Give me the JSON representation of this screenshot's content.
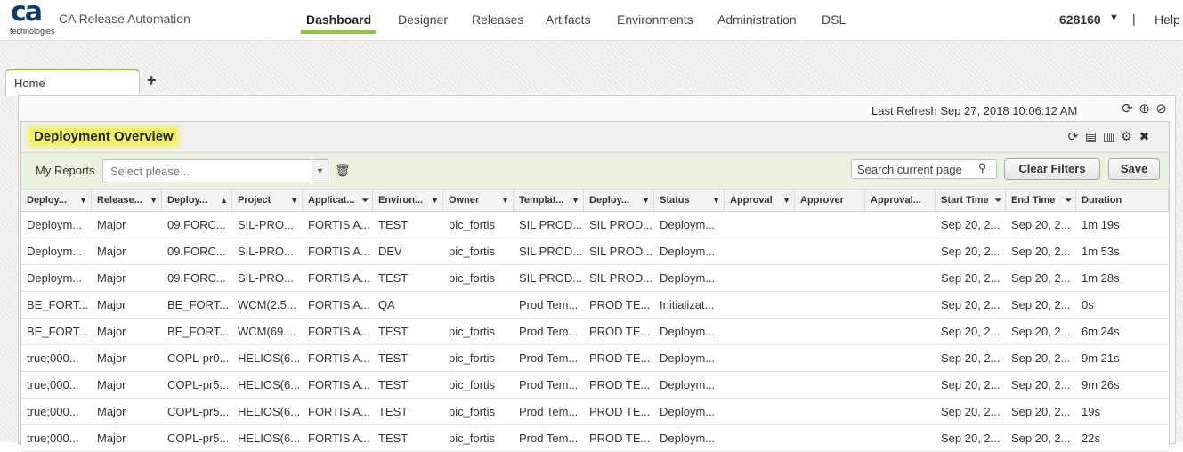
{
  "app": {
    "logo_text": "ca",
    "logo_sub": "technologies",
    "title": "CA Release Automation"
  },
  "nav": [
    "Dashboard",
    "Designer",
    "Releases",
    "Artifacts",
    "Environments",
    "Administration",
    "DSL"
  ],
  "user": {
    "name": "628160",
    "separator": "|",
    "help": "Help"
  },
  "tabs": {
    "home": "Home",
    "add": "+"
  },
  "dashboard": {
    "last_refresh": "Last Refresh Sep 27, 2018 10:06:12 AM"
  },
  "widget": {
    "title": "Deployment Overview",
    "my_reports_label": "My Reports",
    "select_placeholder": "Select please...",
    "search_placeholder": "Search current page",
    "clear_filters": "Clear Filters",
    "save": "Save"
  },
  "columns": [
    "Deploy...",
    "Release...",
    "Deploy...",
    "Project",
    "Applicat...",
    "Environ...",
    "Owner",
    "Templat...",
    "Deploy...",
    "Status",
    "Approval",
    "Approver",
    "Approval...",
    "Start Time",
    "End Time",
    "Duration"
  ],
  "rows": [
    [
      "Deploym...",
      "Major",
      "09.FORC...",
      "SIL-PRO...",
      "FORTIS A...",
      "TEST",
      "pic_fortis",
      "SIL PROD...",
      "SIL PROD...",
      "Deploym...",
      "",
      "",
      "",
      "Sep 20, 2...",
      "Sep 20, 2...",
      "1m 19s"
    ],
    [
      "Deploym...",
      "Major",
      "09.FORC...",
      "SIL-PRO...",
      "FORTIS A...",
      "DEV",
      "pic_fortis",
      "SIL PROD...",
      "SIL PROD...",
      "Deploym...",
      "",
      "",
      "",
      "Sep 20, 2...",
      "Sep 20, 2...",
      "1m 53s"
    ],
    [
      "Deploym...",
      "Major",
      "09.FORC...",
      "SIL-PRO...",
      "FORTIS A...",
      "TEST",
      "pic_fortis",
      "SIL PROD...",
      "SIL PROD...",
      "Deploym...",
      "",
      "",
      "",
      "Sep 20, 2...",
      "Sep 20, 2...",
      "1m 28s"
    ],
    [
      "BE_FORT...",
      "Major",
      "BE_FORT...",
      "WCM(2.5...",
      "FORTIS A...",
      "QA",
      "",
      "Prod Tem...",
      "PROD TE...",
      "Initializat...",
      "",
      "",
      "",
      "Sep 20, 2...",
      "Sep 20, 2...",
      "0s"
    ],
    [
      "BE_FORT...",
      "Major",
      "BE_FORT...",
      "WCM(69....",
      "FORTIS A...",
      "TEST",
      "pic_fortis",
      "Prod Tem...",
      "PROD TE...",
      "Deploym...",
      "",
      "",
      "",
      "Sep 20, 2...",
      "Sep 20, 2...",
      "6m 24s"
    ],
    [
      "true;000...",
      "Major",
      "COPL-pr0...",
      "HELIOS(6...",
      "FORTIS A...",
      "TEST",
      "pic_fortis",
      "Prod Tem...",
      "PROD TE...",
      "Deploym...",
      "",
      "",
      "",
      "Sep 20, 2...",
      "Sep 20, 2...",
      "9m 21s"
    ],
    [
      "true;000...",
      "Major",
      "COPL-pr5...",
      "HELIOS(6...",
      "FORTIS A...",
      "TEST",
      "pic_fortis",
      "Prod Tem...",
      "PROD TE...",
      "Deploym...",
      "",
      "",
      "",
      "Sep 20, 2...",
      "Sep 20, 2...",
      "9m 26s"
    ],
    [
      "true;000...",
      "Major",
      "COPL-pr5...",
      "HELIOS(6...",
      "FORTIS A...",
      "TEST",
      "pic_fortis",
      "Prod Tem...",
      "PROD TE...",
      "Deploym...",
      "",
      "",
      "",
      "Sep 20, 2...",
      "Sep 20, 2...",
      "19s"
    ],
    [
      "true;000...",
      "Major",
      "COPL-pr5...",
      "HELIOS(6...",
      "FORTIS A...",
      "TEST",
      "pic_fortis",
      "Prod Tem...",
      "PROD TE...",
      "Deploym...",
      "",
      "",
      "",
      "Sep 20, 2...",
      "Sep 20, 2...",
      "22s"
    ]
  ]
}
